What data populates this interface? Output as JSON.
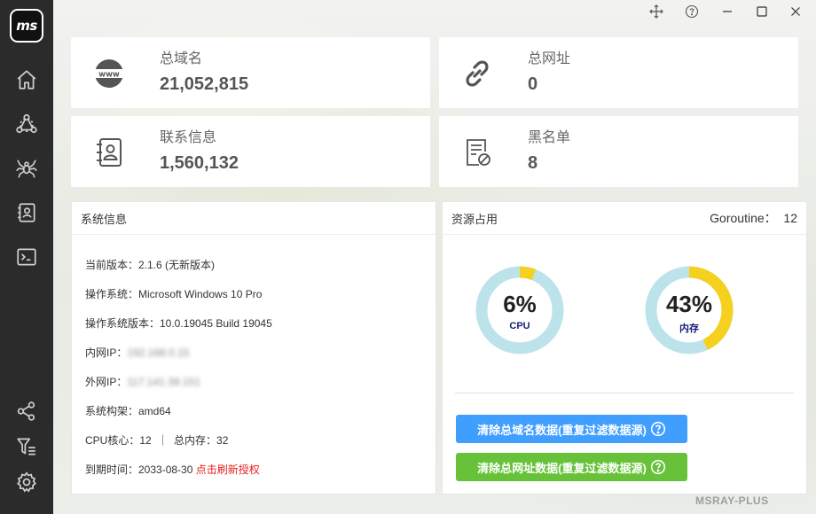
{
  "app": {
    "logo_text": "ms",
    "brand": "MSRAY-PLUS"
  },
  "window_controls": [
    "move-icon",
    "help-icon",
    "minimize-icon",
    "maximize-icon",
    "close-icon"
  ],
  "sidebar": {
    "top_icons": [
      "home-icon",
      "network-nodes-icon",
      "spider-icon",
      "contact-book-icon",
      "terminal-icon"
    ],
    "bottom_icons": [
      "share-icon",
      "filter-list-icon",
      "settings-icon"
    ]
  },
  "stats": [
    {
      "label": "总域名",
      "value": "21,052,815",
      "icon": "www-icon"
    },
    {
      "label": "总网址",
      "value": "0",
      "icon": "link-icon"
    },
    {
      "label": "联系信息",
      "value": "1,560,132",
      "icon": "contact-icon"
    },
    {
      "label": "黑名单",
      "value": "8",
      "icon": "blacklist-icon"
    }
  ],
  "system_info": {
    "title": "系统信息",
    "version": "当前版本：2.1.6 (无新版本)",
    "os": "操作系统：Microsoft Windows 10 Pro",
    "os_version": "操作系统版本：10.0.19045 Build 19045",
    "lan_ip_label": "内网IP：",
    "lan_ip_value": "192.168.0.15",
    "wan_ip_label": "外网IP：",
    "wan_ip_value": "117.141.39.151",
    "arch": "系统构架：amd64",
    "cpu_mem": "CPU核心：12  ｜  总内存：32",
    "expire_label": "到期时间：2033-08-30 ",
    "renew_link": "点击刷新授权"
  },
  "resources": {
    "title": "资源占用",
    "goroutine": "Goroutine：  12",
    "cpu": {
      "percent": 6,
      "percent_text": "6%",
      "label": "CPU"
    },
    "memory": {
      "percent": 43,
      "percent_text": "43%",
      "label": "内存"
    },
    "gauge_track_color": "#bde3ea",
    "gauge_fill_color": "#f5d11f",
    "clear_domains_button": "清除总域名数据(重复过滤数据源)",
    "clear_urls_button": "清除总网址数据(重复过滤数据源)"
  }
}
